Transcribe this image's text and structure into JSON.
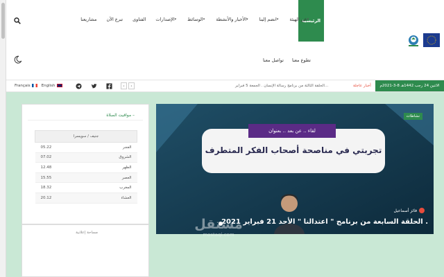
{
  "nav": {
    "home": "الرئيسية",
    "items": [
      {
        "label": "عن الهيئة",
        "caret": true
      },
      {
        "label": "انضم إلينا",
        "caret": true
      },
      {
        "label": "الأخبار والأنشطة",
        "caret": true
      },
      {
        "label": "الوسائط",
        "caret": true
      },
      {
        "label": "الإصدارات",
        "caret": true
      },
      {
        "label": "الفتاوى",
        "caret": false
      },
      {
        "label": "تبرع الآن",
        "caret": false
      },
      {
        "label": "مشاريعنا",
        "caret": false
      }
    ],
    "row2": [
      "تطوع معنا",
      "تواصل معنا"
    ]
  },
  "ticker": {
    "date": "الاثنين 24 رجب 1442هـ 8-3-2021م",
    "urgent": "أخبار عاجلة",
    "news": "الحلقة الثالثة من برنامج رسالة الإنسان . الجمعة 5 فبراير...",
    "lang_en": "English",
    "lang_fr": "Français"
  },
  "prayer": {
    "title": "مواقيت الصلاة",
    "location": "جنيف / سويسرا",
    "rows": [
      {
        "name": "الفجر",
        "time": "05.22"
      },
      {
        "name": "الشروق",
        "time": "07.02"
      },
      {
        "name": "الظهر",
        "time": "12.48"
      },
      {
        "name": "العصر",
        "time": "15.55"
      },
      {
        "name": "المغرب",
        "time": "18.32"
      },
      {
        "name": "العشاء",
        "time": "20.12"
      }
    ]
  },
  "ad": {
    "label": "مساحة إعلانية"
  },
  "slider": {
    "badge": "نشاطات",
    "author": "فائز أسماعيل",
    "caption": "الحلقة السابعة من برنامج \" اعتدالنا \" الأحد 21 فبراير 2021 .",
    "banner_top": "لقاء .. عن بعد .. بعنوان",
    "banner_main": "تجربتي في مناصحة أصحاب الفكر المتطرف"
  },
  "watermark": {
    "ar": "مستقل",
    "en": "mostaql.com"
  },
  "colors": {
    "primary": "#2e8b4e",
    "background": "#c9e8d5",
    "urgent": "#e74c3c"
  }
}
